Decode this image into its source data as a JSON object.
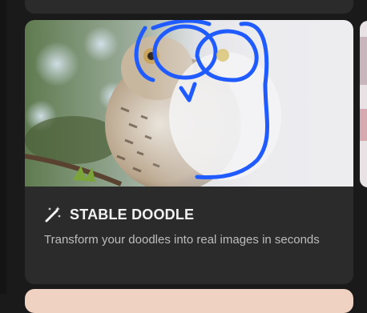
{
  "card": {
    "title": "STABLE DOODLE",
    "description": "Transform your doodles into real images in seconds",
    "icon": "magic-wand-icon",
    "image_alt": "owl-photo-with-doodle-overlay"
  },
  "colors": {
    "page_background": "#1a1a1a",
    "card_background": "#2b2b2b",
    "title_text": "#f2f2f2",
    "description_text": "#bdbdbd",
    "doodle_stroke": "#1f5bff"
  }
}
